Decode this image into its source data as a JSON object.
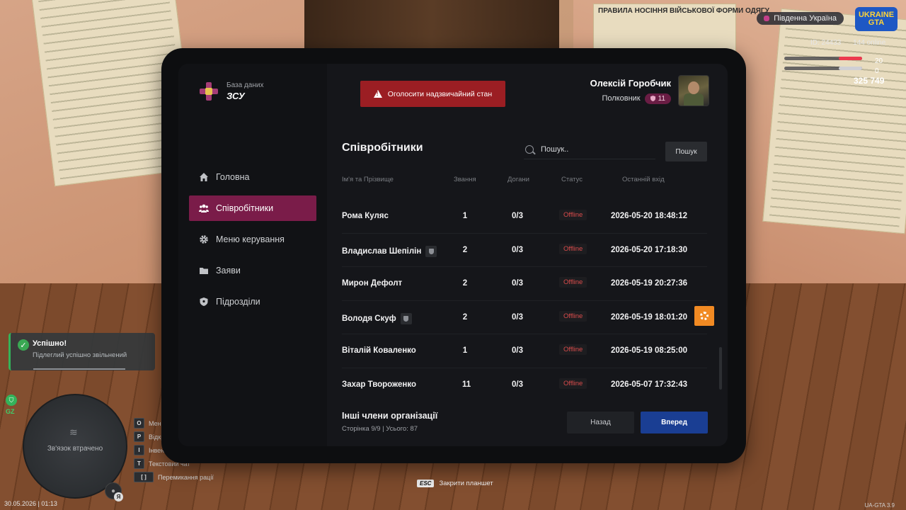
{
  "hud": {
    "region": "Південна Україна",
    "logo": "UKRAINE GTA",
    "id_label": "ID: 24433",
    "online_label": "144 online",
    "stat_health": "20",
    "stat_armor": "0",
    "money": "325 749",
    "datetime": "30.05.2026 | 01:13",
    "version": "UA-GTA 3.9",
    "gz_label": "GZ",
    "minimap_message": "Зв'язок втрачено",
    "voice_key": "Я"
  },
  "notification": {
    "title": "Успішно!",
    "text": "Підлеглий успішно звільнений"
  },
  "hotkeys": [
    {
      "key": "O",
      "label": "Меню"
    },
    {
      "key": "P",
      "label": "Відкрити"
    },
    {
      "key": "I",
      "label": "Інвентар"
    },
    {
      "key": "T",
      "label": "Текстовий чат"
    },
    {
      "key": "[ ]",
      "label": "Перемикання рації"
    }
  ],
  "esc_hint": {
    "key": "ESC",
    "label": "Закрити планшет"
  },
  "poster_title": "ПРАВИЛА НОСІННЯ ВІЙСЬКОВОЇ ФОРМИ ОДЯГУ",
  "brand": {
    "subtitle": "База даних",
    "name": "ЗСУ"
  },
  "nav": [
    {
      "label": "Головна",
      "icon": "home-icon"
    },
    {
      "label": "Співробітники",
      "icon": "users-icon",
      "active": true
    },
    {
      "label": "Меню керування",
      "icon": "gear-icon"
    },
    {
      "label": "Заяви",
      "icon": "folder-icon"
    },
    {
      "label": "Підрозділи",
      "icon": "shield-icon"
    }
  ],
  "emergency_button": "Оголосити надзвичайний стан",
  "profile": {
    "name": "Олексій Горобчик",
    "rank": "Полковник",
    "rank_level": "11"
  },
  "section": {
    "title": "Співробітники"
  },
  "search": {
    "placeholder": "Пошук..",
    "button": "Пошук"
  },
  "table": {
    "headers": [
      "Ім'я та Прізвище",
      "Звання",
      "Догани",
      "Статус",
      "Останній вхід"
    ],
    "rows": [
      {
        "name": "Рома Куляс",
        "rank": "1",
        "warnings": "0/3",
        "status": "Offline",
        "last_login": "2026-05-20 18:48:12",
        "leader": false
      },
      {
        "name": "Владислав Шепілін",
        "rank": "2",
        "warnings": "0/3",
        "status": "Offline",
        "last_login": "2026-05-20 17:18:30",
        "leader": true
      },
      {
        "name": "Мирон Дефолт",
        "rank": "2",
        "warnings": "0/3",
        "status": "Offline",
        "last_login": "2026-05-19 20:27:36",
        "leader": false
      },
      {
        "name": "Володя Скуф",
        "rank": "2",
        "warnings": "0/3",
        "status": "Offline",
        "last_login": "2026-05-19 18:01:20",
        "leader": true
      },
      {
        "name": "Віталій Коваленко",
        "rank": "1",
        "warnings": "0/3",
        "status": "Offline",
        "last_login": "2026-05-19 08:25:00",
        "leader": false
      },
      {
        "name": "Захар Твороженко",
        "rank": "11",
        "warnings": "0/3",
        "status": "Offline",
        "last_login": "2026-05-07 17:32:43",
        "leader": false
      }
    ]
  },
  "footer": {
    "title": "Інші члени організації",
    "pagination": "Сторінка 9/9 | Усього: 87",
    "back": "Назад",
    "next": "Вперед"
  },
  "colors": {
    "accent": "#7a1c49",
    "emergency": "#9b1e23",
    "primary_button": "#1a3e93",
    "gear_button": "#f18a23",
    "offline": "#d94b4b"
  }
}
